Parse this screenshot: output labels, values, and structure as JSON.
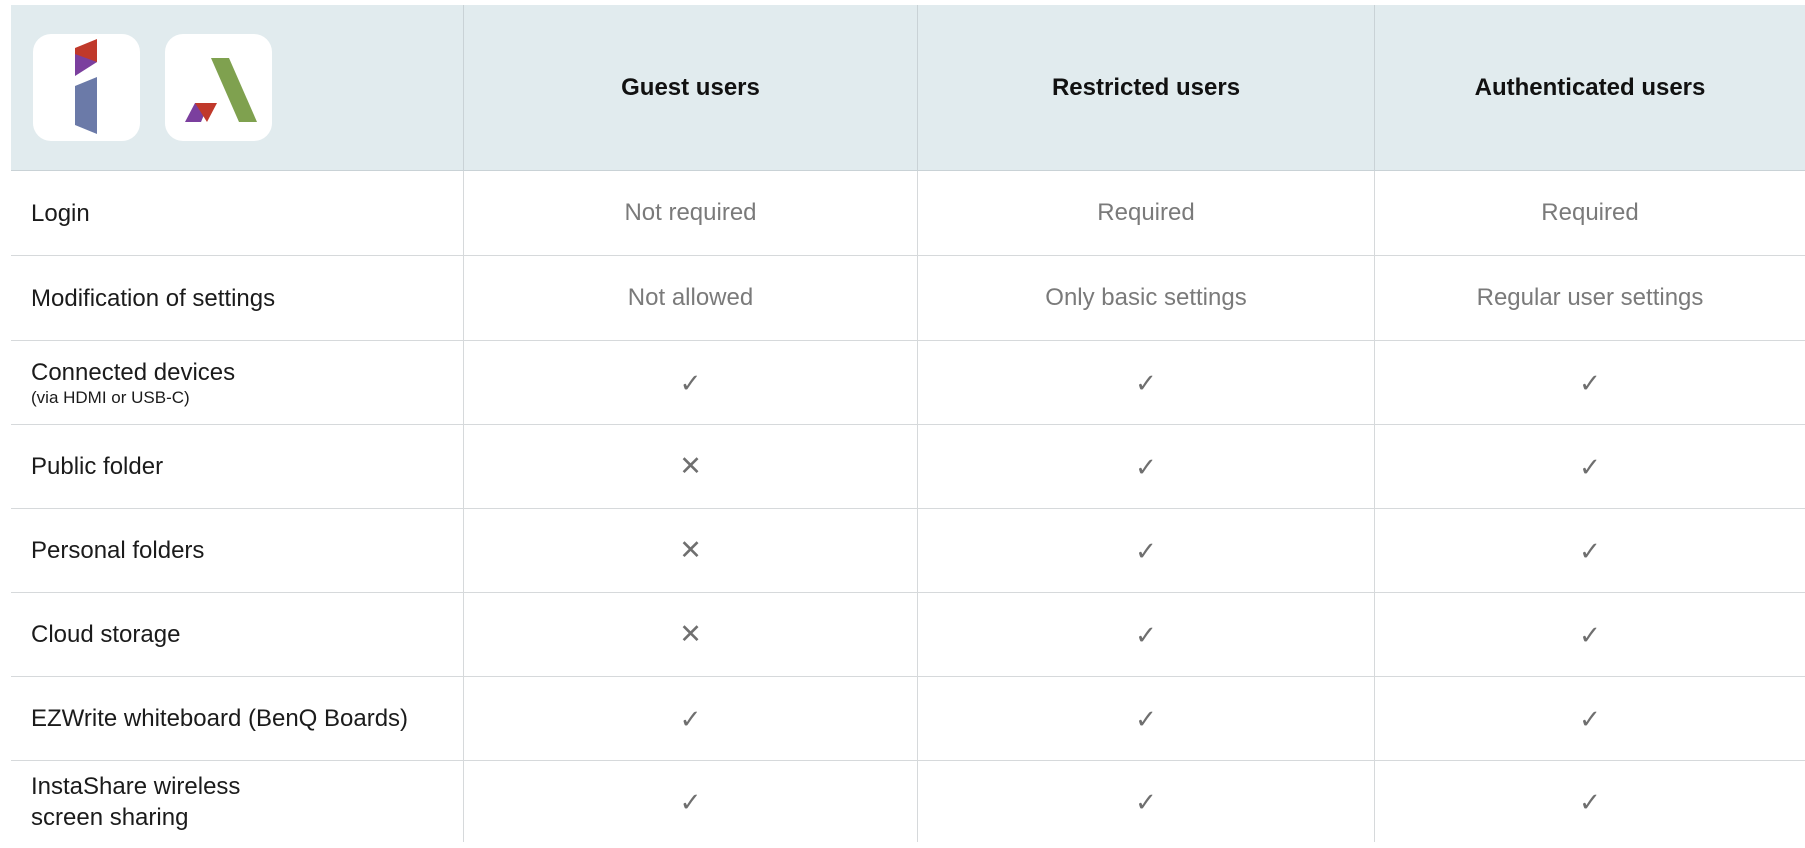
{
  "header": {
    "columns": [
      "Guest users",
      "Restricted users",
      "Authenticated users"
    ],
    "logo_icons": [
      "brand-i-logo-icon",
      "brand-a-logo-icon"
    ]
  },
  "marks": {
    "check": "✓",
    "cross": "✕"
  },
  "colors": {
    "header_bg": "#e1ebee",
    "logo_red": "#c0392b",
    "logo_purple": "#7b3f9e",
    "logo_slate": "#6b7aa8",
    "logo_green": "#7fa14f",
    "value_gray": "#7a7a7a"
  },
  "rows": [
    {
      "label": "Login",
      "sub": "",
      "values": [
        "Not required",
        "Required",
        "Required"
      ]
    },
    {
      "label": "Modification of settings",
      "sub": "",
      "values": [
        "Not allowed",
        "Only basic settings",
        "Regular user settings"
      ]
    },
    {
      "label": "Connected devices",
      "sub": "(via HDMI or USB-C)",
      "values": [
        "check",
        "check",
        "check"
      ]
    },
    {
      "label": "Public folder",
      "sub": "",
      "values": [
        "cross",
        "check",
        "check"
      ]
    },
    {
      "label": "Personal folders",
      "sub": "",
      "values": [
        "cross",
        "check",
        "check"
      ]
    },
    {
      "label": "Cloud storage",
      "sub": "",
      "values": [
        "cross",
        "check",
        "check"
      ]
    },
    {
      "label": "EZWrite whiteboard (BenQ Boards)",
      "sub": "",
      "values": [
        "check",
        "check",
        "check"
      ]
    },
    {
      "label": "InstaShare wireless",
      "sub": "screen sharing",
      "values": [
        "check",
        "check",
        "check"
      ]
    }
  ]
}
